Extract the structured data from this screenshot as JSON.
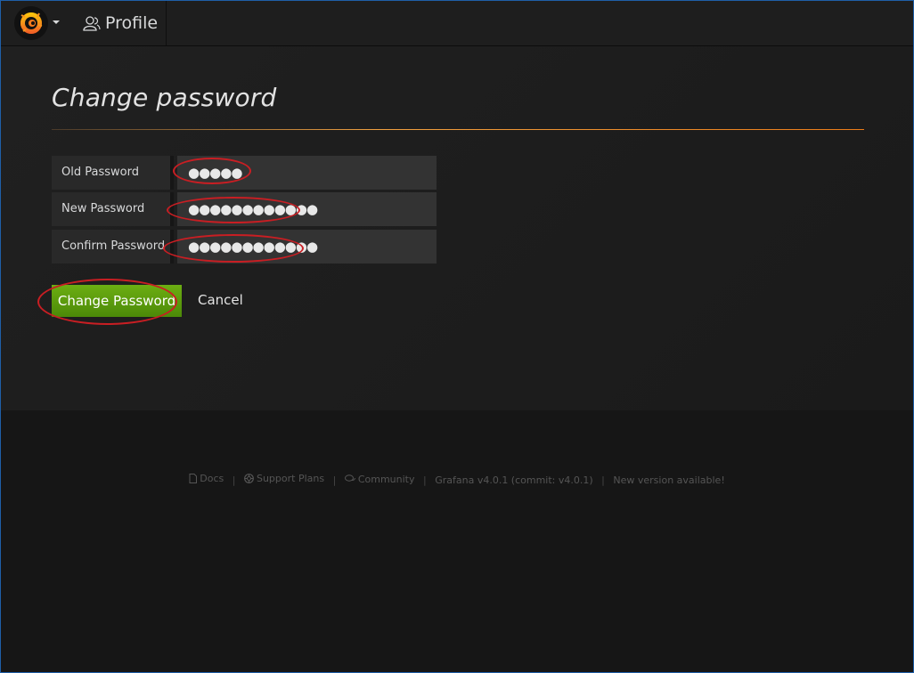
{
  "navbar": {
    "profile_label": "Profile"
  },
  "page": {
    "title": "Change password"
  },
  "form": {
    "fields": [
      {
        "label": "Old Password",
        "masked_value": "●●●●●"
      },
      {
        "label": "New Password",
        "masked_value": "●●●●●●●●●●●●"
      },
      {
        "label": "Confirm Password",
        "masked_value": "●●●●●●●●●●●●"
      }
    ],
    "submit_label": "Change Password",
    "cancel_label": "Cancel"
  },
  "footer": {
    "docs": "Docs",
    "support": "Support Plans",
    "community": "Community",
    "version": "Grafana v4.0.1 (commit: v4.0.1)",
    "new_version": "New version available!",
    "separator": "|"
  },
  "colors": {
    "accent_green": "#5c9c0e",
    "annotation_red": "#c91e23",
    "title_rule_orange": "#eb7b18"
  }
}
